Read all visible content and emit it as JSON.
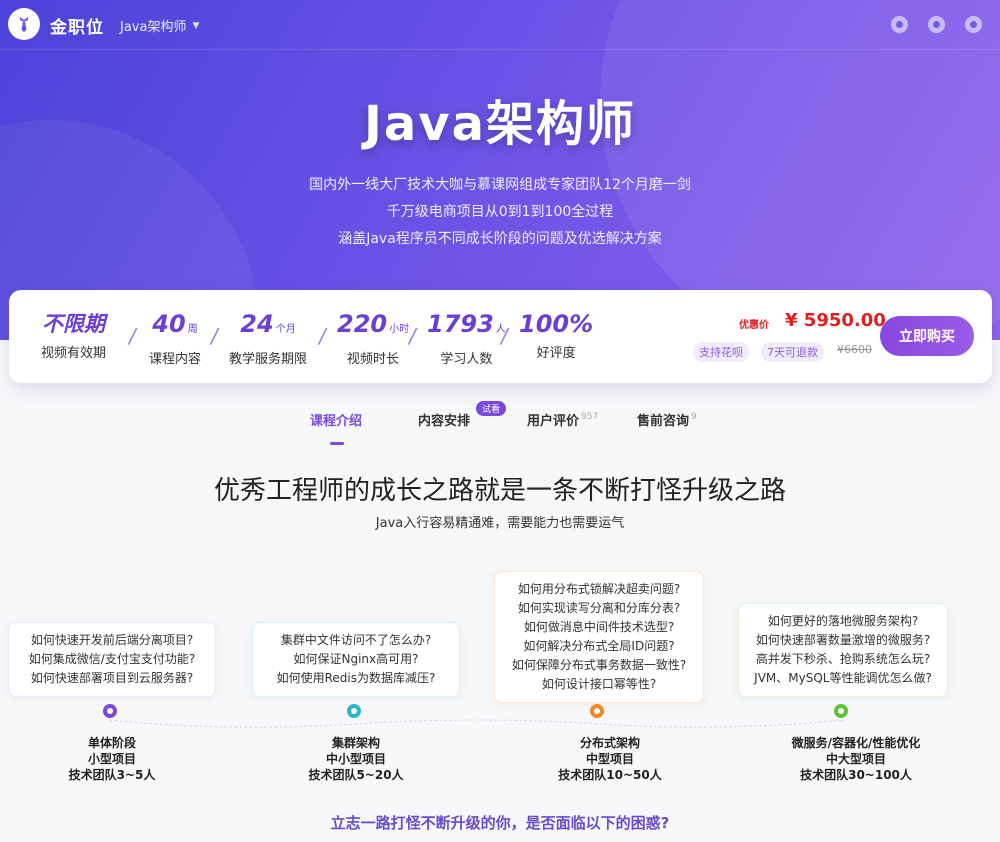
{
  "header": {
    "brand": "金职位",
    "course_menu": "Java架构师",
    "colors": {
      "accent": "#7a4ad8",
      "price": "#e02020"
    }
  },
  "hero": {
    "title": "Java架构师",
    "lines": [
      "国内外一线大厂技术大咖与慕课网组成专家团队12个月磨一剑",
      "千万级电商项目从0到1到100全过程",
      "涵盖Java程序员不同成长阶段的问题及优选解决方案"
    ]
  },
  "stats": [
    {
      "value": "不限期",
      "unit": "",
      "label": "视频有效期"
    },
    {
      "value": "40",
      "unit": "周",
      "label": "课程内容"
    },
    {
      "value": "24",
      "unit": "个月",
      "label": "教学服务期限"
    },
    {
      "value": "220",
      "unit": "小时",
      "label": "视频时长"
    },
    {
      "value": "1793",
      "unit": "人",
      "label": "学习人数"
    },
    {
      "value": "100%",
      "unit": "",
      "label": "好评度"
    }
  ],
  "price": {
    "tag": "优惠价",
    "current": "¥ 5950.00",
    "badge1": "支持花呗",
    "badge2": "7天可退款",
    "old": "¥6600",
    "buy_label": "立即购买"
  },
  "tabs": [
    {
      "label": "课程介绍",
      "count": ""
    },
    {
      "label": "内容安排",
      "count": ""
    },
    {
      "label": "用户评价",
      "count": "957"
    },
    {
      "label": "售前咨询",
      "count": "9"
    }
  ],
  "try_badge": "试看",
  "section": {
    "title": "优秀工程师的成长之路就是一条不断打怪升级之路",
    "subtitle": "Java入行容易精通难，需要能力也需要运气"
  },
  "stages": [
    {
      "questions": [
        "如何快速开发前后端分离项目?",
        "如何集成微信/支付宝支付功能?",
        "如何快速部署项目到云服务器?"
      ],
      "name": "单体阶段",
      "scale": "小型项目",
      "team": "技术团队3~5人",
      "color": "#7a4ad8"
    },
    {
      "questions": [
        "集群中文件访问不了怎么办?",
        "如何保证Nginx高可用?",
        "如何使用Redis为数据库减压?"
      ],
      "name": "集群架构",
      "scale": "中小型项目",
      "team": "技术团队5~20人",
      "color": "#2bb6c9"
    },
    {
      "questions": [
        "如何用分布式锁解决超卖问题?",
        "如何实现读写分离和分库分表?",
        "如何做消息中间件技术选型?",
        "如何解决分布式全局ID问题?",
        "如何保障分布式事务数据一致性?",
        "如何设计接口幂等性?"
      ],
      "name": "分布式架构",
      "scale": "中型项目",
      "team": "技术团队10~50人",
      "color": "#f08a24"
    },
    {
      "questions": [
        "如何更好的落地微服务架构?",
        "如何快速部署数量激增的微服务?",
        "高并发下秒杀、抢购系统怎么玩?",
        "JVM、MySQL等性能调优怎么做?"
      ],
      "name": "微服务/容器化/性能优化",
      "scale": "中大型项目",
      "team": "技术团队30~100人",
      "color": "#5cc23a"
    }
  ],
  "bottom_question": "立志一路打怪不断升级的你，是否面临以下的困惑?"
}
